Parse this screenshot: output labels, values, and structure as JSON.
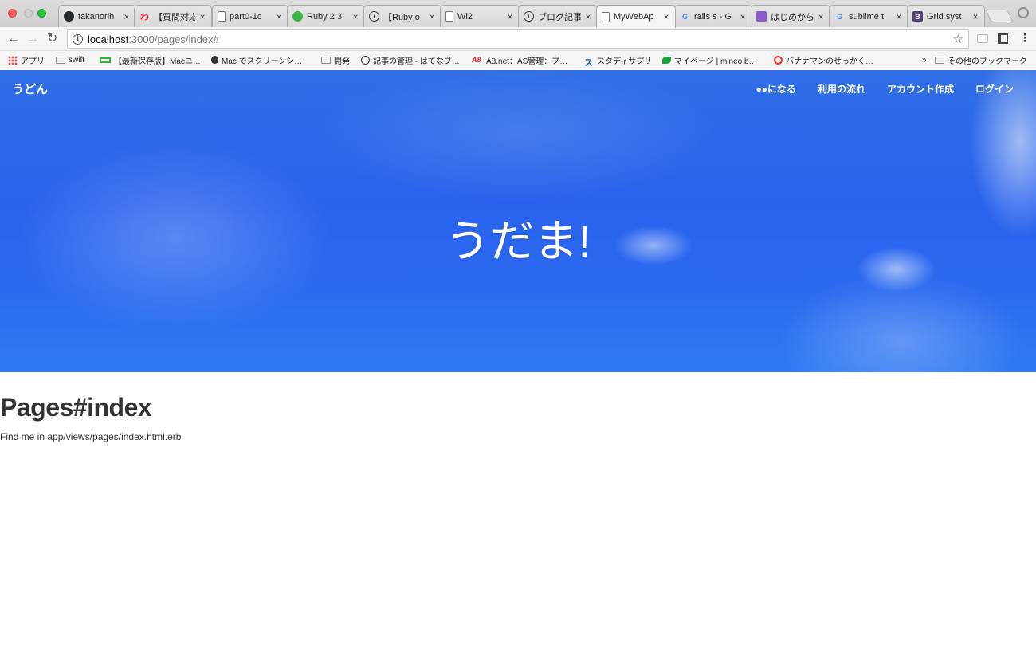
{
  "browser": {
    "tabs": [
      {
        "title": "takanorih",
        "icon": "github-icon",
        "color": "#24292e",
        "glyph": "●"
      },
      {
        "title": "【質問対応",
        "icon": "hatena-icon",
        "color": "#e33",
        "glyph": "わ"
      },
      {
        "title": "part0-1c",
        "icon": "page-icon",
        "color": "",
        "glyph": "▯"
      },
      {
        "title": "Ruby 2.3",
        "icon": "search-magnifier-icon",
        "color": "#3bb54a",
        "glyph": "●"
      },
      {
        "title": "【Ruby o",
        "icon": "info-site-icon",
        "color": "",
        "glyph": "ⓘ"
      },
      {
        "title": "Wl2",
        "icon": "page-icon",
        "color": "",
        "glyph": "▯"
      },
      {
        "title": "ブログ記事",
        "icon": "info-site-icon",
        "color": "",
        "glyph": "ⓘ"
      },
      {
        "title": "MyWebAp",
        "icon": "page-icon",
        "color": "",
        "glyph": "▯"
      },
      {
        "title": "rails s - G",
        "icon": "google-icon",
        "color": "#4285f4",
        "glyph": "G"
      },
      {
        "title": "はじめから",
        "icon": "site-icon",
        "color": "#8a5cc8",
        "glyph": "▦"
      },
      {
        "title": "sublime t",
        "icon": "google-icon",
        "color": "#4285f4",
        "glyph": "G"
      },
      {
        "title": "Grid syst",
        "icon": "bootstrap-icon",
        "color": "#563d7c",
        "glyph": "B"
      }
    ],
    "url_host": "localhost",
    "url_path": ":3000/pages/index#",
    "bookmarks": [
      {
        "label": "アプリ",
        "icon": "apps-grid-icon"
      },
      {
        "label": "swift",
        "icon": "folder-icon"
      },
      {
        "label": "【最新保存版】Macユ…",
        "icon": "bookmark-green-icon"
      },
      {
        "label": "Mac でスクリーンシ…",
        "icon": "apple-icon"
      },
      {
        "label": "開発",
        "icon": "folder-icon"
      },
      {
        "label": "記事の管理 - はてなブ…",
        "icon": "info-site-icon"
      },
      {
        "label": "A8.net：AS管理：プ…",
        "icon": "a8-icon"
      },
      {
        "label": "スタディサプリ",
        "icon": "studysapuri-icon"
      },
      {
        "label": "マイページ | mineo b…",
        "icon": "mineo-icon"
      },
      {
        "label": "バナナマンのせっかく…",
        "icon": "banana-icon"
      }
    ],
    "bookmarks_overflow": "»",
    "other_bookmarks": "その他のブックマーク"
  },
  "site": {
    "brand": "うどん",
    "nav": [
      "●●になる",
      "利用の流れ",
      "アカウント作成",
      "ログイン"
    ],
    "hero_title": "うだま!"
  },
  "content": {
    "heading": "Pages#index",
    "text": "Find me in app/views/pages/index.html.erb"
  }
}
